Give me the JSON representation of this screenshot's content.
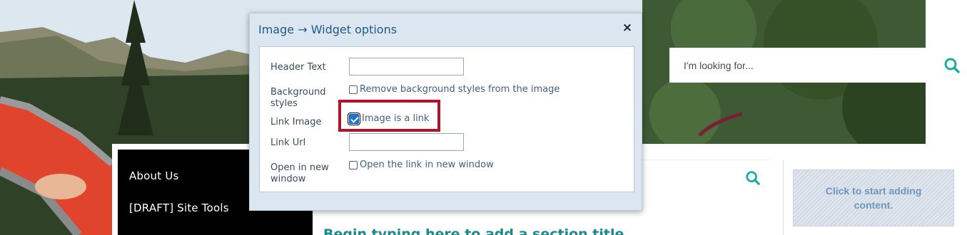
{
  "search": {
    "placeholder": "I'm looking for...",
    "icon": "search-icon"
  },
  "nav": {
    "items": [
      {
        "label": "About Us"
      },
      {
        "label": "[DRAFT] Site Tools"
      }
    ]
  },
  "content": {
    "add_content_label": "Click to start adding content.",
    "section_title_placeholder": "Begin typing here to add a section title"
  },
  "modal": {
    "title": "Image → Widget options",
    "close_symbol": "×",
    "fields": {
      "header_text": {
        "label": "Header Text",
        "value": ""
      },
      "background_styles": {
        "label": "Background styles",
        "checkbox_label": "Remove background styles from the image",
        "checked": false
      },
      "link_image": {
        "label": "Link Image",
        "checkbox_label": "Image is a link",
        "checked": true
      },
      "link_url": {
        "label": "Link Url",
        "value": ""
      },
      "open_new_window": {
        "label": "Open in new window",
        "checkbox_label": "Open the link in new window",
        "checked": false
      }
    }
  },
  "colors": {
    "accent_teal": "#1aaea0",
    "highlight_red": "#b4122b",
    "modal_title_blue": "#1f5a8c",
    "nav_black": "#000000"
  }
}
